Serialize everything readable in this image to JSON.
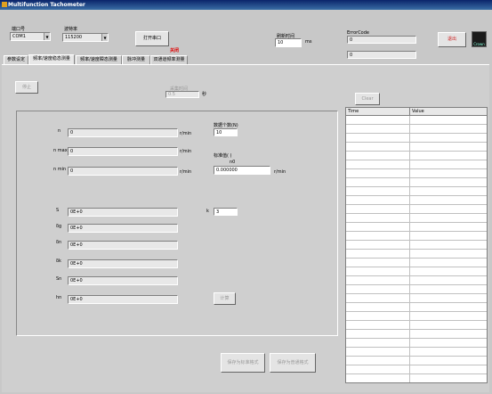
{
  "window": {
    "title": "Multifunction Tachometer"
  },
  "top": {
    "port_label": "端口号",
    "port_value": "COM1",
    "baud_label": "波特率",
    "baud_value": "115200",
    "open_button": "打开串口",
    "status_text": "关闭",
    "refresh_label": "刷新时间",
    "refresh_value": "10",
    "refresh_unit": "ms",
    "error_label": "ErrorCode",
    "error_value": "0",
    "error_value2": "0",
    "exit_button": "退出",
    "logo_text": "Crown"
  },
  "tabs": [
    {
      "label": "参数设定"
    },
    {
      "label": "频率/速度稳态测量"
    },
    {
      "label": "频率/速度瞬态测量"
    },
    {
      "label": "脉冲测量"
    },
    {
      "label": "双通道频率测量"
    }
  ],
  "controls": {
    "stop_button": "停止",
    "sample_time_label": "采集时间",
    "sample_time_value": "0.5",
    "sample_time_unit": "秒",
    "clear_button": "Clear"
  },
  "measure": {
    "n_label": "n",
    "n_value": "0",
    "nmax_label": "n max",
    "nmax_value": "0",
    "nmin_label": "n min",
    "nmin_value": "0",
    "unit": "r/min",
    "data_count_label": "数据个数(N)",
    "data_count_value": "10",
    "std_label": "标准值(   )",
    "std_sub": "n0",
    "std_value": "0.000000",
    "std_unit": "r/min",
    "s_label": "S",
    "dg_label": "δg",
    "dh_label": "δn",
    "dk_label": "δk",
    "sn_label": "Sn",
    "hn_label": "hn",
    "stat_values": [
      "0E+0",
      "0E+0",
      "0E+0",
      "0E+0",
      "0E+0",
      "0E+0"
    ],
    "k_label": "k",
    "k_value": "3",
    "calc_button": "计算"
  },
  "bottom": {
    "save_std": "保存为标准格式",
    "save_plain": "保存为普通格式"
  },
  "grid": {
    "headers": [
      "Time",
      "Value"
    ]
  },
  "colors": {
    "exit_red": "#cc2020",
    "status_red": "#e00000",
    "title_blue": "#0a246a"
  }
}
